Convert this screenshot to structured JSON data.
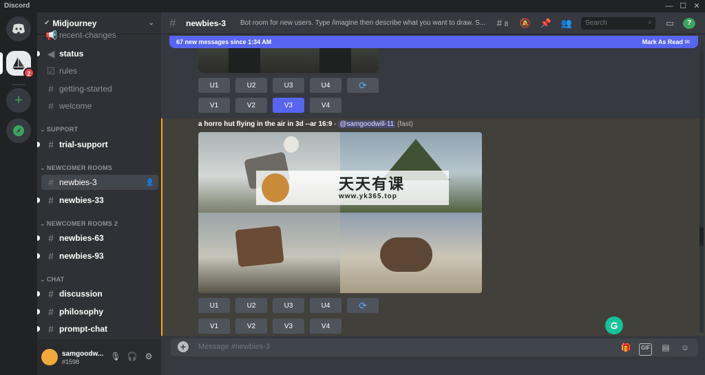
{
  "app": {
    "title": "Discord"
  },
  "window": {
    "minimize": "—",
    "maximize": "☐",
    "close": "✕"
  },
  "servers": {
    "unread_badge": "2"
  },
  "guild": {
    "name": "Midjourney"
  },
  "channels": {
    "partial_top": "recent-changes",
    "items": [
      {
        "label": "status"
      },
      {
        "label": "rules"
      },
      {
        "label": "getting-started"
      },
      {
        "label": "welcome"
      }
    ],
    "support_cat": "SUPPORT",
    "trial_support": "trial-support",
    "newcomer_cat": "NEWCOMER ROOMS",
    "newbies_3": "newbies-3",
    "newbies_33": "newbies-33",
    "newcomer2_cat": "NEWCOMER ROOMS 2",
    "newbies_63": "newbies-63",
    "newbies_93": "newbies-93",
    "chat_cat": "CHAT",
    "discussion": "discussion",
    "philosophy": "philosophy",
    "prompt_chat": "prompt-chat"
  },
  "user": {
    "name": "samgoodw...",
    "tag": "#1598"
  },
  "topbar": {
    "channel": "newbies-3",
    "topic": "Bot room for new users. Type /imagine then describe what you want to draw. S...",
    "thread_count": "8",
    "search_placeholder": "Search"
  },
  "new_messages": {
    "text": "67 new messages since 1:34 AM",
    "mark_read": "Mark As Read"
  },
  "buttons": {
    "u1": "U1",
    "u2": "U2",
    "u3": "U3",
    "u4": "U4",
    "v1": "V1",
    "v2": "V2",
    "v3": "V3",
    "v4": "V4"
  },
  "message": {
    "prompt": "a horro hut flying in the air in 3d --ar 16:9",
    "separator": " - ",
    "mention": "@samgoodwill-11",
    "mode": " (fast)"
  },
  "watermark": {
    "title": "天天有课",
    "url": "www.yk365.top"
  },
  "composer": {
    "placeholder": "Message #newbies-3",
    "gif": "GIF"
  },
  "colors": {
    "blurple": "#5865f2",
    "highlight_border": "#faa81a",
    "background": "#36393f"
  }
}
